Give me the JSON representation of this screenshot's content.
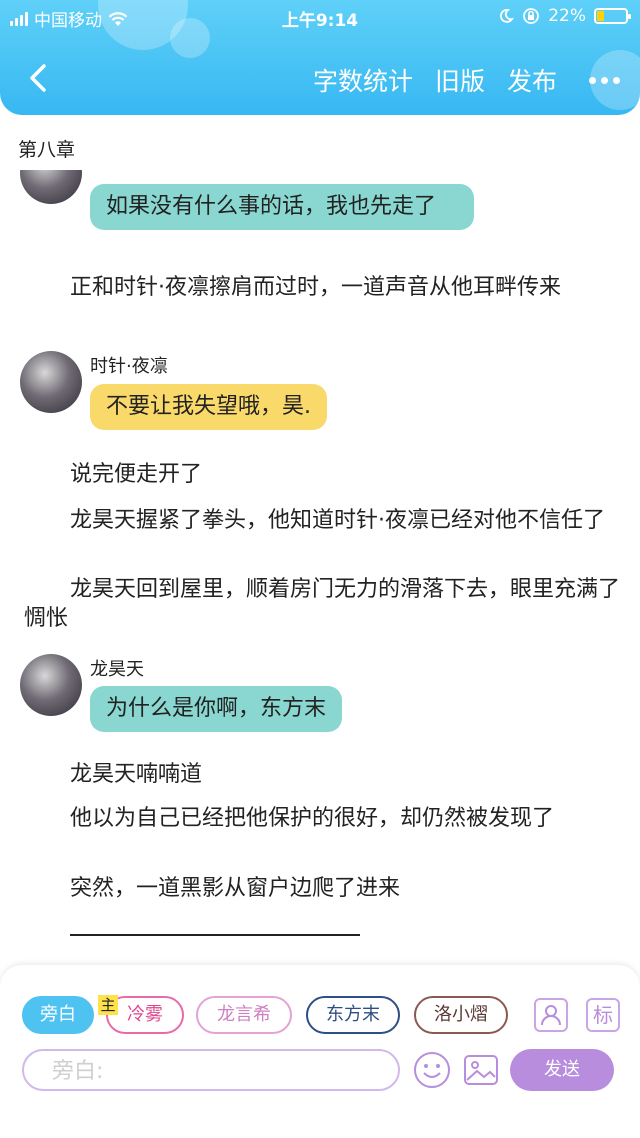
{
  "status_bar": {
    "carrier": "中国移动",
    "time": "上午9:14",
    "battery": "22%",
    "battery_level": 0.22
  },
  "nav": {
    "word_count": "字数统计",
    "old_version": "旧版",
    "publish": "发布"
  },
  "chapter_title": "第八章",
  "messages": {
    "bubble1": "如果没有什么事的话，我也先走了",
    "para1": "正和时针·夜凛擦肩而过时，一道声音从他耳畔传来",
    "speaker2": "时针·夜凛",
    "bubble2": "不要让我失望哦，昊.",
    "para2": "说完便走开了",
    "para3": "龙昊天握紧了拳头，他知道时针·夜凛已经对他不信任了",
    "para4": "龙昊天回到屋里，顺着房门无力的滑落下去，眼里充满了惆怅",
    "speaker3": "龙昊天",
    "bubble3": "为什么是你啊，东方末",
    "para5": "龙昊天喃喃道",
    "para6": "他以为自己已经把他保护的很好，却仍然被发现了",
    "para7": "突然，一道黑影从窗户边爬了进来"
  },
  "composer": {
    "characters": [
      "旁白",
      "冷雾",
      "龙言希",
      "东方末",
      "洛小熠"
    ],
    "main_tag": "主",
    "mark_icon_label": "标",
    "placeholder": "旁白:",
    "send_label": "发送"
  },
  "colors": {
    "header": "#37b8f2",
    "bubble_teal": "#89d7d0",
    "bubble_yellow": "#fad96b",
    "accent_purple": "#b98ddd"
  }
}
